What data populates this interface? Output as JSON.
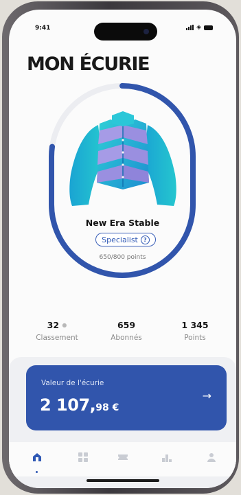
{
  "status_bar": {
    "time": "9:41"
  },
  "page_title": "MON ÉCURIE",
  "stable": {
    "name": "New Era Stable",
    "level_badge": "Specialist",
    "points_text": "650/800 points",
    "points_current": 650,
    "points_target": 800
  },
  "stats": [
    {
      "value": "32",
      "label": "Classement"
    },
    {
      "value": "659",
      "label": "Abonnés"
    },
    {
      "value": "1 345",
      "label": "Points"
    }
  ],
  "value_card": {
    "label": "Valeur de l'écurie",
    "amount_main": "2 107,",
    "amount_cents": "98 €"
  },
  "tabs": [
    {
      "icon": "stable-icon",
      "active": true
    },
    {
      "icon": "grid-icon",
      "active": false
    },
    {
      "icon": "ticket-icon",
      "active": false
    },
    {
      "icon": "podium-icon",
      "active": false
    },
    {
      "icon": "profile-icon",
      "active": false
    }
  ],
  "colors": {
    "accent": "#3155ac",
    "ring_track": "#ecedf1",
    "jacket_cyan": "#22b8d4",
    "jacket_lilac": "#9a8fe0",
    "tab_inactive": "#c9ccd3"
  }
}
